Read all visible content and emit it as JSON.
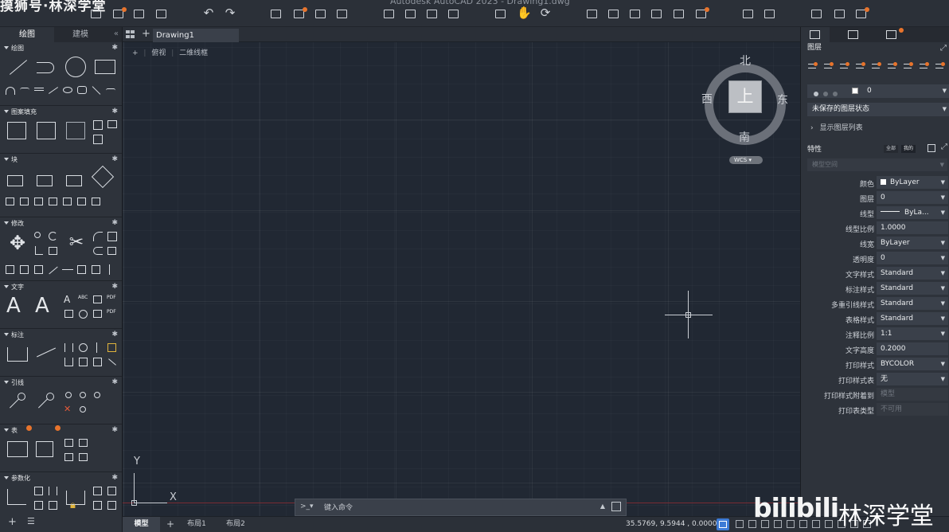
{
  "watermark_top": "摸狮号·林深学堂",
  "app_title": "Autodesk AutoCAD 2023 - Drawing1.dwg",
  "left_palette": {
    "tabs": [
      "绘图",
      "建模"
    ],
    "collapse": "«",
    "sections": [
      "绘图",
      "图案填充",
      "块",
      "修改",
      "文字",
      "标注",
      "引线",
      "表",
      "参数化"
    ],
    "bottom_plus": "+",
    "bottom_menu": "☰"
  },
  "document": {
    "tab_label": "Drawing1",
    "view_controls": [
      "+",
      "俯视",
      "二维线框"
    ]
  },
  "viewcube": {
    "top": "上",
    "north": "北",
    "south": "南",
    "west": "西",
    "east": "东",
    "wcs": "WCS ▾"
  },
  "ucs": {
    "x": "X",
    "y": "Y"
  },
  "command_line": {
    "prompt": ">_▾",
    "placeholder": "键入命令"
  },
  "status_bar": {
    "tabs": [
      "模型",
      "+",
      "布局1",
      "布局2"
    ],
    "coords": "35.5769, 9.5944 , 0.0000"
  },
  "right_palette": {
    "layers_title": "图层",
    "current_layer": "0",
    "layer_state": "未保存的图层状态",
    "show_layer_list": "显示图层列表",
    "properties_title": "特性",
    "prop_btn_all": "全部",
    "prop_btn_mine": "我的",
    "model_space": "模型空间",
    "properties": [
      {
        "label": "颜色",
        "value": "ByLayer",
        "kind": "swatch"
      },
      {
        "label": "图层",
        "value": "0",
        "kind": "dropdown"
      },
      {
        "label": "线型",
        "value": "ByLa...",
        "kind": "line"
      },
      {
        "label": "线型比例",
        "value": "1.0000",
        "kind": "text"
      },
      {
        "label": "线宽",
        "value": "ByLayer",
        "kind": "dropdown"
      },
      {
        "label": "透明度",
        "value": "0",
        "kind": "dropdown"
      },
      {
        "label": "文字样式",
        "value": "Standard",
        "kind": "dropdown"
      },
      {
        "label": "标注样式",
        "value": "Standard",
        "kind": "dropdown"
      },
      {
        "label": "多重引线样式",
        "value": "Standard",
        "kind": "dropdown"
      },
      {
        "label": "表格样式",
        "value": "Standard",
        "kind": "dropdown"
      },
      {
        "label": "注释比例",
        "value": "1:1",
        "kind": "dropdown"
      },
      {
        "label": "文字高度",
        "value": "0.2000",
        "kind": "text"
      },
      {
        "label": "打印样式",
        "value": "BYCOLOR",
        "kind": "dropdown"
      },
      {
        "label": "打印样式表",
        "value": "无",
        "kind": "dropdown"
      },
      {
        "label": "打印样式附着到",
        "value": "模型",
        "kind": "disabled"
      },
      {
        "label": "打印表类型",
        "value": "不可用",
        "kind": "disabled"
      }
    ]
  },
  "bili_watermark": {
    "logo": "bilibili",
    "name": "林深学堂"
  },
  "colors": {
    "accent": "#3d7bd6",
    "badge": "#e8742c",
    "canvas": "#212833"
  }
}
